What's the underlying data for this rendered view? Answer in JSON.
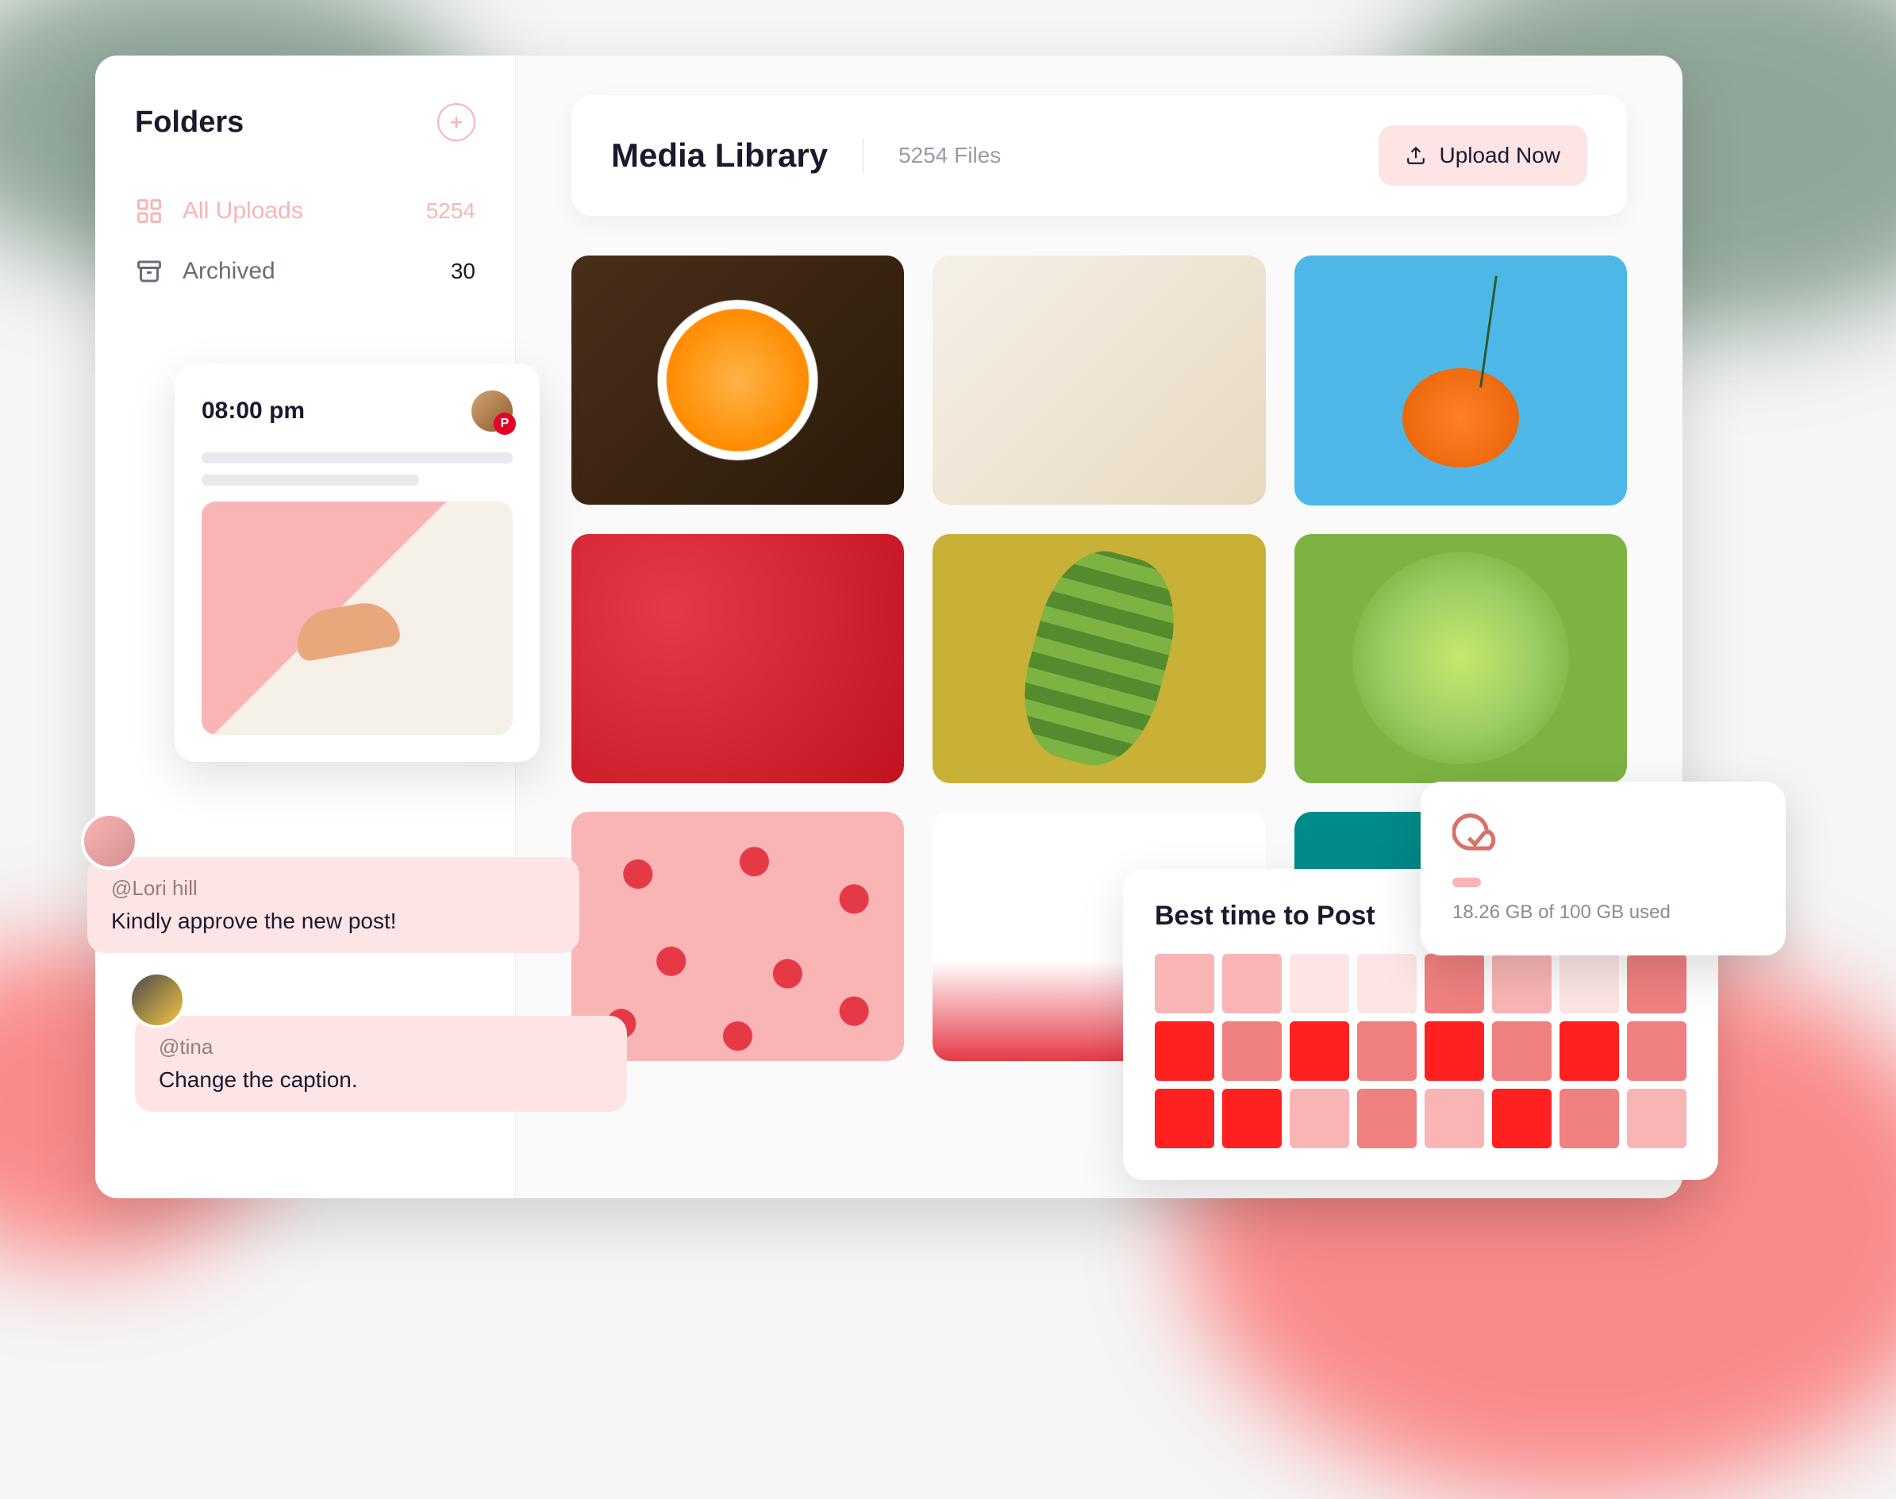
{
  "sidebar": {
    "title": "Folders",
    "nav": [
      {
        "label": "All Uploads",
        "count": "5254"
      },
      {
        "label": "Archived",
        "count": "30"
      }
    ]
  },
  "header": {
    "title": "Media Library",
    "file_count": "5254 Files",
    "upload_label": "Upload Now"
  },
  "post_card": {
    "time": "08:00 pm",
    "pin_badge": "P"
  },
  "comments": [
    {
      "user": "@Lori hill",
      "text": "Kindly approve the new post!"
    },
    {
      "user": "@tina",
      "text": "Change the caption."
    }
  ],
  "heatmap": {
    "title": "Best time to Post",
    "cells": [
      1,
      1,
      0,
      0,
      2,
      1,
      0,
      2,
      3,
      2,
      3,
      2,
      3,
      2,
      3,
      2,
      3,
      3,
      1,
      2,
      1,
      3,
      2,
      1
    ]
  },
  "storage": {
    "text": "18.26 GB of 100 GB used"
  },
  "colors": {
    "accent_light": "#fde5e5",
    "accent": "#f9b5b5",
    "accent_strong": "#ff2020",
    "pinterest": "#e60023"
  }
}
